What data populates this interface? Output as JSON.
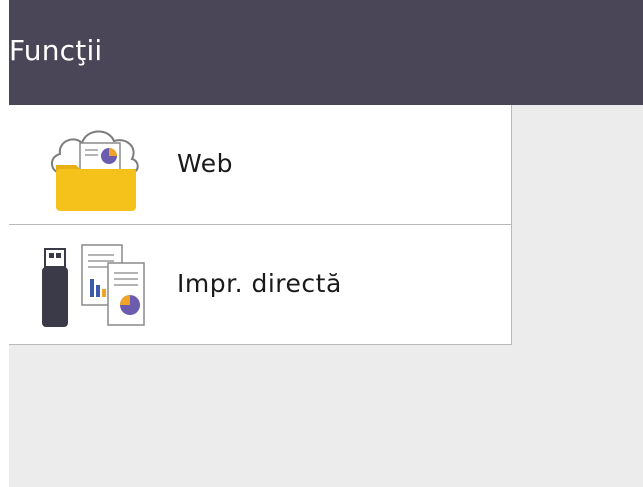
{
  "header": {
    "title": "Funcţii"
  },
  "menu": {
    "items": [
      {
        "label": "Web",
        "icon": "web-cloud-folder-icon"
      },
      {
        "label": "Impr. directă",
        "icon": "usb-direct-print-icon"
      }
    ]
  },
  "colors": {
    "titlebar": "#4a4557",
    "background": "#ececec",
    "folder": "#f5c21b",
    "usb": "#3b3a48",
    "pie_purple": "#6b5cae",
    "pie_orange": "#f0a325"
  }
}
